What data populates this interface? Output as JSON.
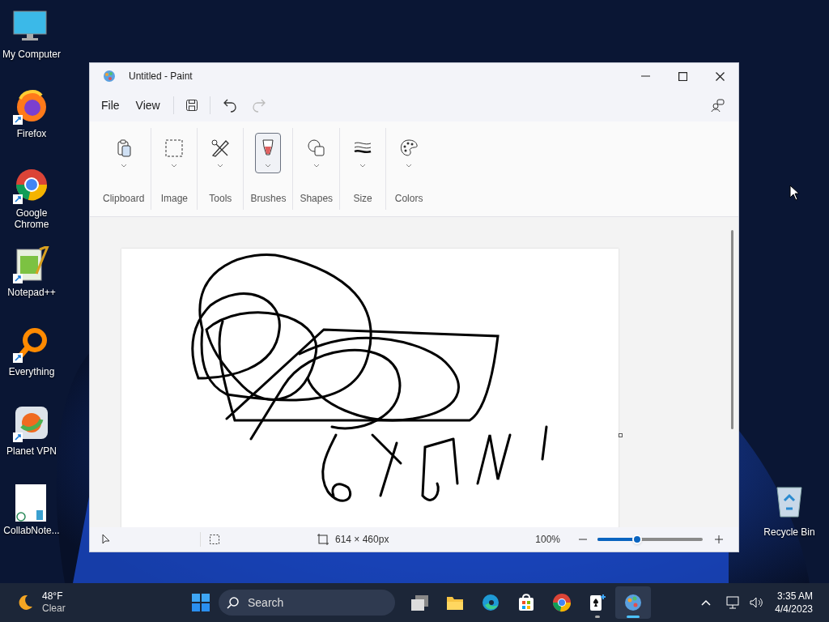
{
  "desktop_icons": [
    {
      "kind": "computer",
      "label": "My Computer",
      "shortcut": false
    },
    {
      "kind": "firefox",
      "label": "Firefox",
      "shortcut": true
    },
    {
      "kind": "chrome",
      "label": "Google Chrome",
      "shortcut": true
    },
    {
      "kind": "notepad",
      "label": "Notepad++",
      "shortcut": true
    },
    {
      "kind": "everything",
      "label": "Everything",
      "shortcut": true
    },
    {
      "kind": "vpn",
      "label": "Planet VPN",
      "shortcut": true
    },
    {
      "kind": "note",
      "label": "CollabNote...",
      "shortcut": false
    }
  ],
  "recycle_bin": {
    "label": "Recycle Bin"
  },
  "window": {
    "title": "Untitled - Paint",
    "menu": [
      "File",
      "View"
    ],
    "ribbon": [
      {
        "kind": "clipboard",
        "label": "Clipboard",
        "selected": false
      },
      {
        "kind": "image",
        "label": "Image",
        "selected": false
      },
      {
        "kind": "tools",
        "label": "Tools",
        "selected": false
      },
      {
        "kind": "brushes",
        "label": "Brushes",
        "selected": true
      },
      {
        "kind": "shapes",
        "label": "Shapes",
        "selected": false
      },
      {
        "kind": "size",
        "label": "Size",
        "selected": false
      },
      {
        "kind": "colors",
        "label": "Colors",
        "selected": false
      }
    ],
    "redo_disabled": true,
    "status_bar": {
      "canvas_size": "614 × 460px",
      "zoom": "100%",
      "zoom_slider": {
        "level": 0.38
      }
    }
  },
  "taskbar": {
    "weather": {
      "temperature": "48°F",
      "condition": "Clear"
    },
    "search": {
      "placeholder": "Search"
    },
    "apps": [
      {
        "kind": "taskview",
        "running": false,
        "active": false
      },
      {
        "kind": "explorer",
        "running": false,
        "active": false
      },
      {
        "kind": "edge",
        "running": false,
        "active": false
      },
      {
        "kind": "store",
        "running": false,
        "active": false
      },
      {
        "kind": "chrome",
        "running": false,
        "active": false
      },
      {
        "kind": "solitaire",
        "running": true,
        "active": false
      },
      {
        "kind": "paint",
        "running": true,
        "active": true
      }
    ],
    "clock": {
      "time": "3:35 AM",
      "date": "4/4/2023"
    }
  }
}
